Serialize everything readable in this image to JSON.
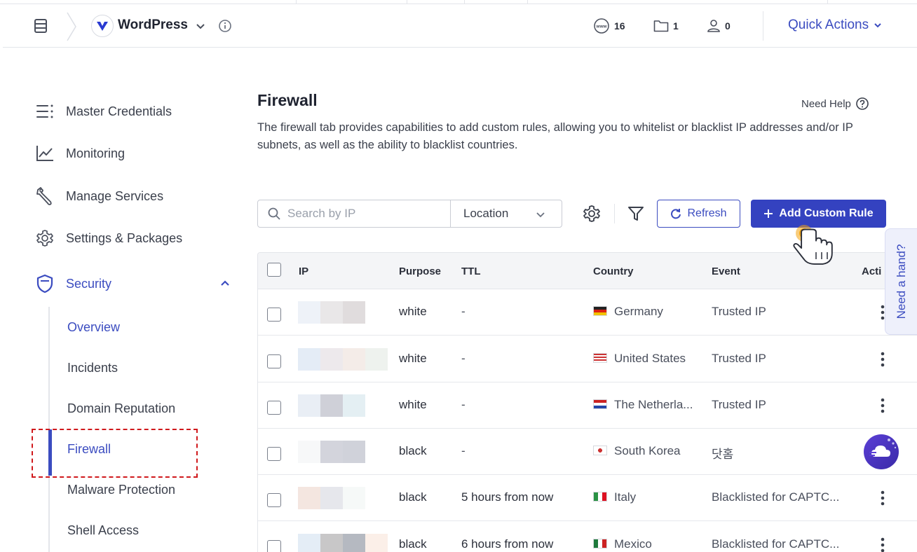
{
  "header": {
    "site_name": "WordPress",
    "stats": {
      "domains": "16",
      "folders": "1",
      "users": "0"
    },
    "quick_actions_label": "Quick Actions"
  },
  "sidebar": {
    "items": [
      {
        "label": "Master Credentials",
        "icon": "list-icon"
      },
      {
        "label": "Monitoring",
        "icon": "chart-icon"
      },
      {
        "label": "Manage Services",
        "icon": "wrench-icon"
      },
      {
        "label": "Settings & Packages",
        "icon": "gear-icon"
      },
      {
        "label": "Security",
        "icon": "shield-icon",
        "active": true
      }
    ],
    "security_sub": [
      "Overview",
      "Incidents",
      "Domain Reputation",
      "Firewall",
      "Malware Protection",
      "Shell Access"
    ],
    "active_sub": "Firewall"
  },
  "main": {
    "title": "Firewall",
    "need_help": "Need Help",
    "description": "The firewall tab provides capabilities to add custom rules, allowing you to whitelist or blacklist IP addresses and/or IP subnets, as well as the ability to blacklist countries."
  },
  "toolbar": {
    "search_placeholder": "Search by IP",
    "location_label": "Location",
    "refresh_label": "Refresh",
    "add_rule_label": "Add Custom Rule"
  },
  "table": {
    "headers": {
      "ip": "IP",
      "purpose": "Purpose",
      "ttl": "TTL",
      "country": "Country",
      "event": "Event",
      "actions": "Acti"
    },
    "rows": [
      {
        "purpose": "white",
        "ttl": "-",
        "country": "Germany",
        "event": "Trusted IP"
      },
      {
        "purpose": "white",
        "ttl": "-",
        "country": "United States",
        "event": "Trusted IP"
      },
      {
        "purpose": "white",
        "ttl": "-",
        "country": "The Netherla...",
        "event": "Trusted IP"
      },
      {
        "purpose": "black",
        "ttl": "-",
        "country": "South Korea",
        "event": "닷홈"
      },
      {
        "purpose": "black",
        "ttl": "5 hours from now",
        "country": "Italy",
        "event": "Blacklisted for CAPTC..."
      },
      {
        "purpose": "black",
        "ttl": "6 hours from now",
        "country": "Mexico",
        "event": "Blacklisted for CAPTC..."
      }
    ]
  },
  "help_tab": "Need a hand?",
  "colors": {
    "accent": "#3b4cc0",
    "primary_button": "#3442c0",
    "highlight_box": "#d0191c"
  }
}
